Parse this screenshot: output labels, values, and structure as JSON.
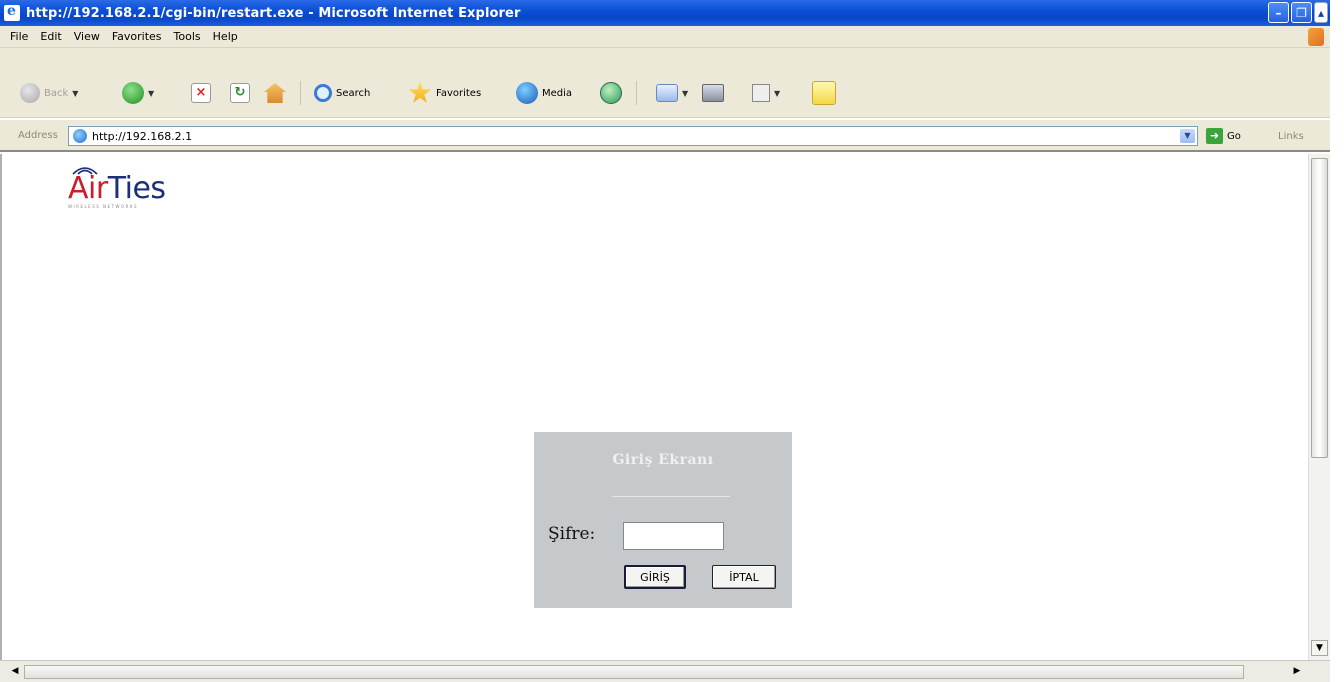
{
  "window": {
    "title": "http://192.168.2.1/cgi-bin/restart.exe - Microsoft Internet Explorer",
    "controls": [
      "minimize",
      "restore",
      "close"
    ]
  },
  "menu": {
    "items": [
      "File",
      "Edit",
      "View",
      "Favorites",
      "Tools",
      "Help"
    ]
  },
  "toolbar": {
    "back_label": "Back",
    "search_label": "Search",
    "favorites_label": "Favorites",
    "media_label": "Media"
  },
  "address": {
    "label": "Address",
    "url": "http://192.168.2.1",
    "go_label": "Go",
    "links_label": "Links"
  },
  "page": {
    "logo": {
      "air": "Air",
      "ties": "Ties",
      "tagline": "WIRELESS NETWORKS"
    },
    "login": {
      "title": "Giriş Ekranı",
      "password_label": "Şifre:",
      "password_value": "",
      "login_button": "GİRİŞ",
      "cancel_button": "İPTAL"
    }
  },
  "colors": {
    "titlebar": "#0a4fd6",
    "chrome": "#ece9d8",
    "login_panel": "#c5c9cb",
    "logo_red": "#c8202a",
    "logo_blue": "#1b2f7a"
  }
}
